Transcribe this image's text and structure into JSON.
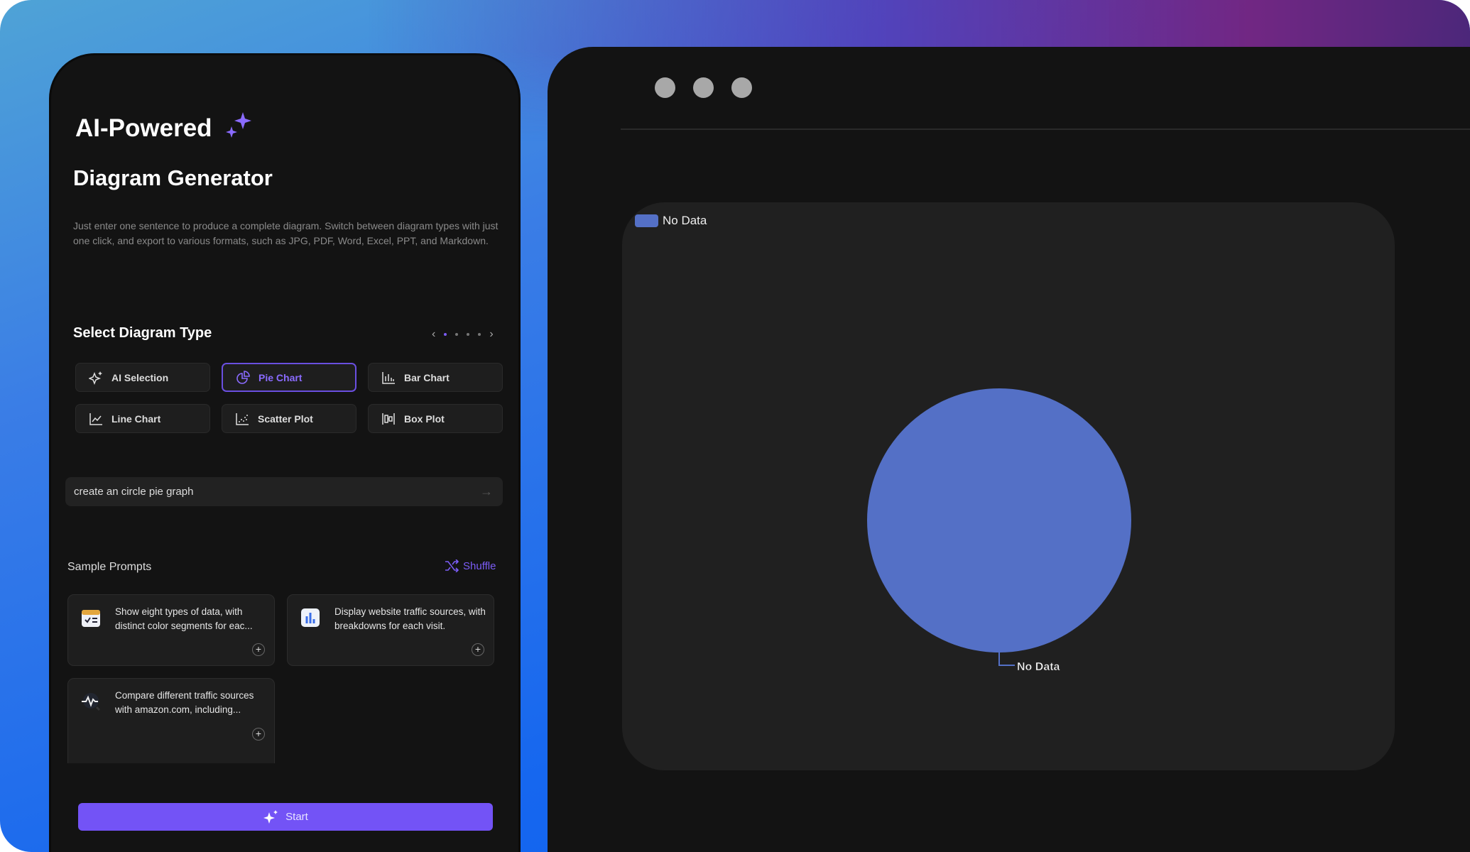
{
  "left": {
    "title_line1": "AI-Powered",
    "title_line2": "Diagram Generator",
    "description": "Just enter one sentence to produce a complete diagram. Switch between diagram types with just one click, and export to various formats, such as JPG, PDF, Word, Excel, PPT, and Markdown.",
    "select_heading": "Select Diagram Type",
    "pager": {
      "pages": 4,
      "current": 1
    },
    "types": [
      {
        "label": "AI Selection",
        "icon": "sparkle-icon",
        "selected": false
      },
      {
        "label": "Pie Chart",
        "icon": "pie-chart-icon",
        "selected": true
      },
      {
        "label": "Bar Chart",
        "icon": "bar-chart-icon",
        "selected": false
      },
      {
        "label": "Line Chart",
        "icon": "line-chart-icon",
        "selected": false
      },
      {
        "label": "Scatter Plot",
        "icon": "scatter-plot-icon",
        "selected": false
      },
      {
        "label": "Box Plot",
        "icon": "box-plot-icon",
        "selected": false
      }
    ],
    "prompt_value": "create an circle pie graph",
    "sample_heading": "Sample Prompts",
    "shuffle_label": "Shuffle",
    "samples": [
      {
        "text": "Show eight types of data, with distinct color segments for eac...",
        "icon": "calendar-checklist-icon"
      },
      {
        "text": "Display website traffic sources, with breakdowns for each visit.",
        "icon": "bar-chart-app-icon"
      },
      {
        "text": "Compare different traffic sources with amazon.com, including...",
        "icon": "activity-search-icon"
      }
    ],
    "start_label": "Start",
    "accent": "#7353f6"
  },
  "chart_data": {
    "type": "pie",
    "legend": [
      {
        "name": "No Data",
        "color": "#5470c6"
      }
    ],
    "slices": [
      {
        "label": "No Data",
        "value": 1,
        "color": "#5470c6"
      }
    ],
    "legend_position": "top-left"
  }
}
